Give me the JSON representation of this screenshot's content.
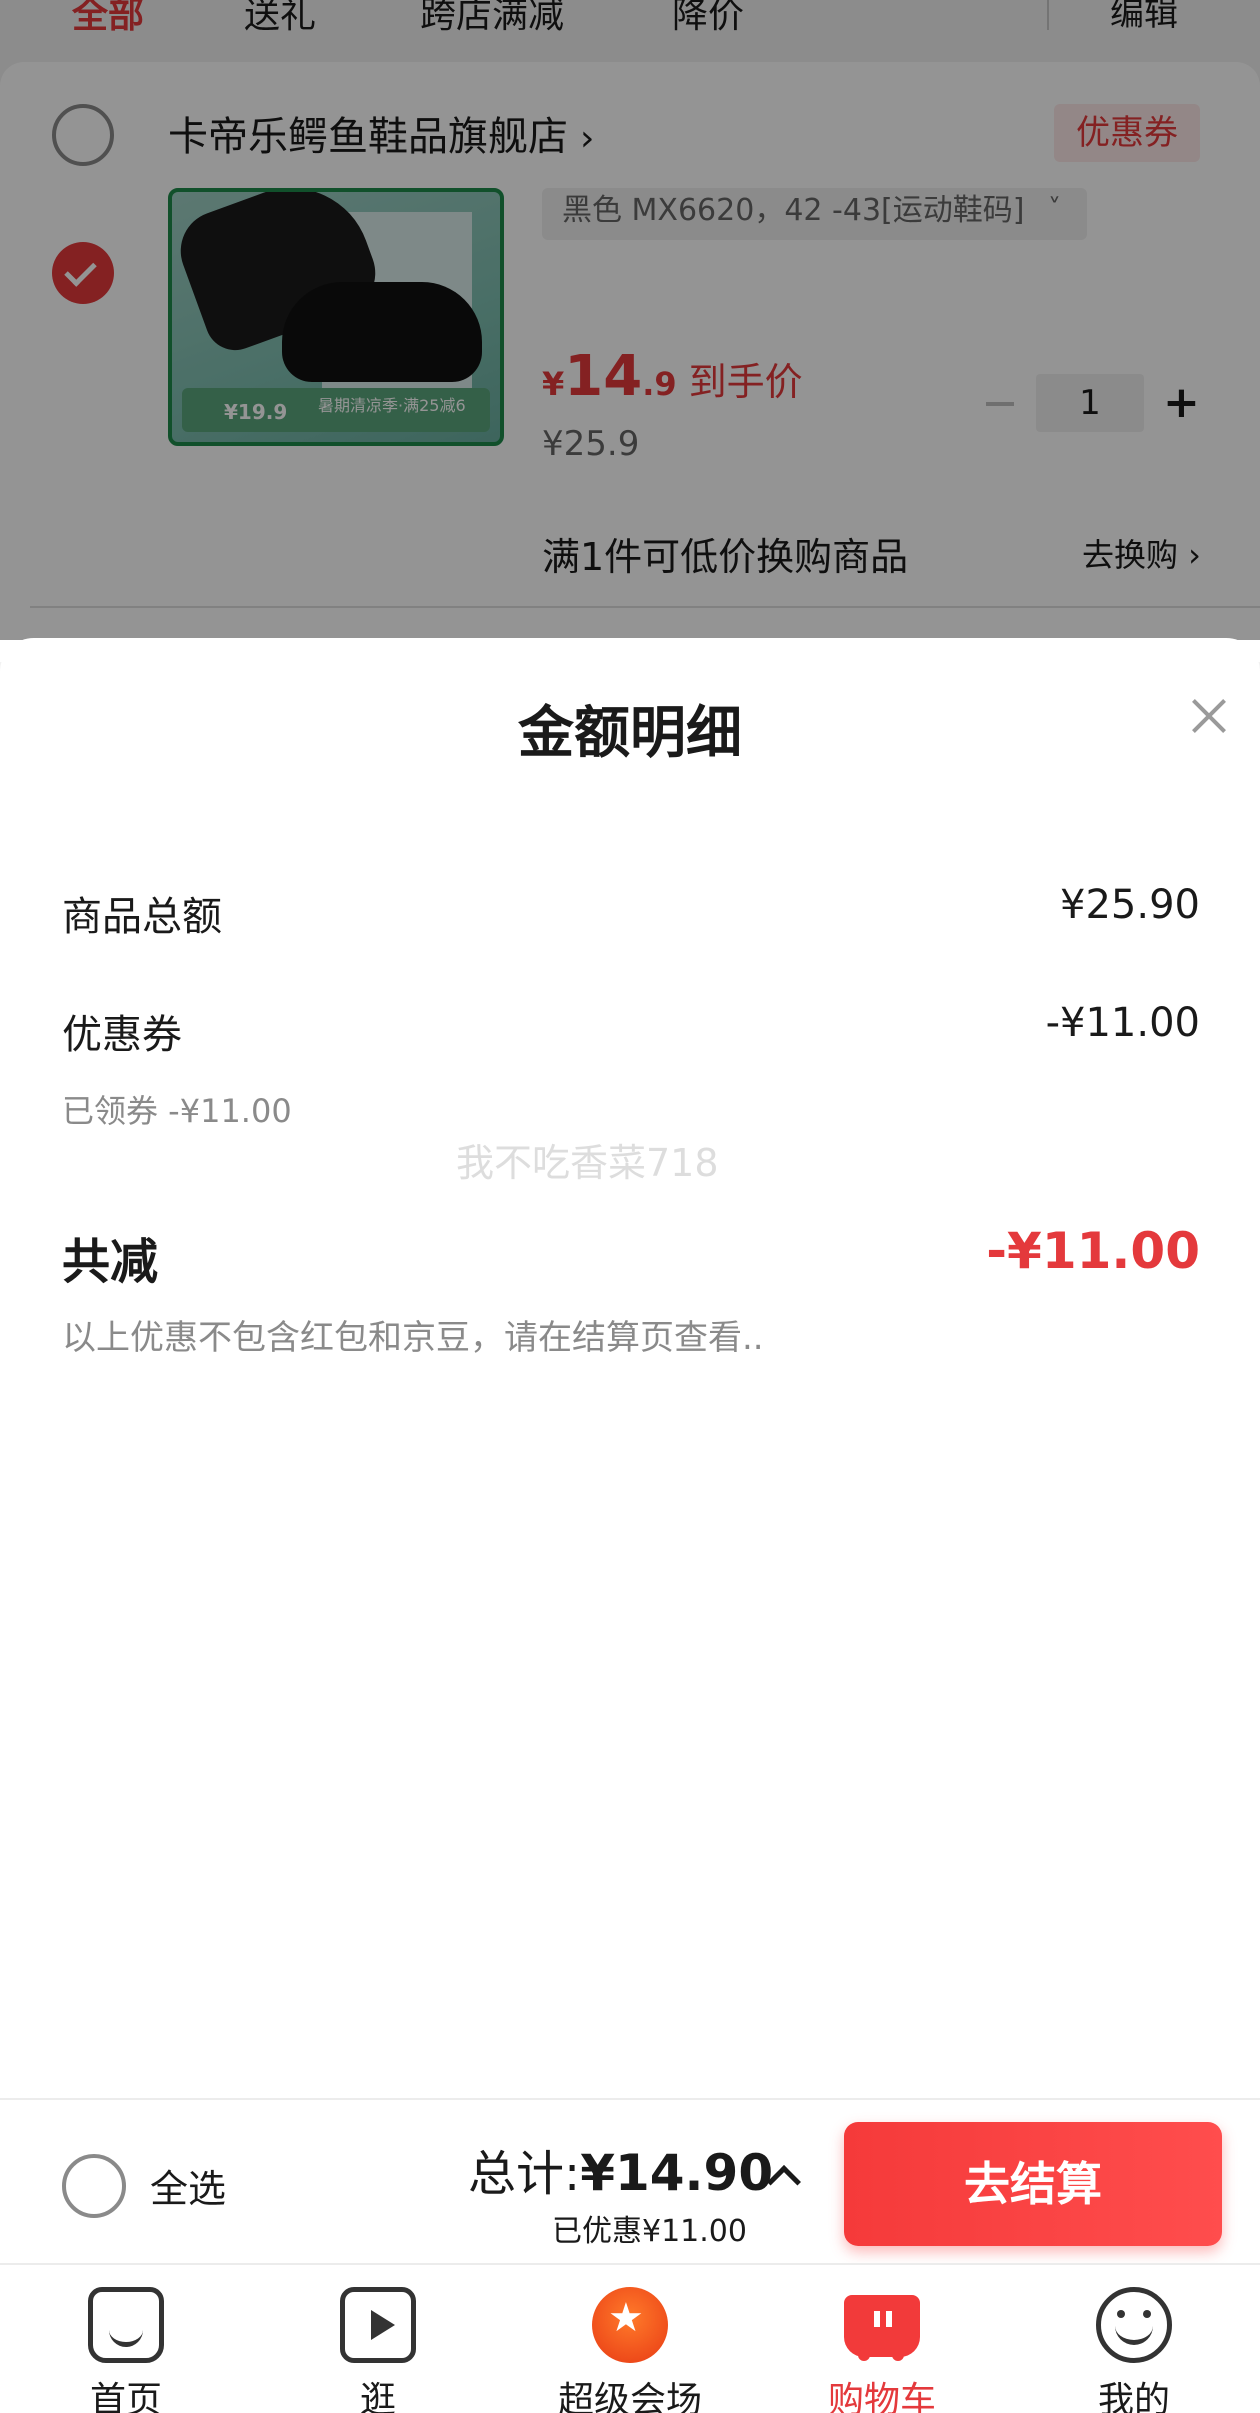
{
  "tabs": {
    "items": [
      {
        "label": "全部",
        "active": true
      },
      {
        "label": "送礼"
      },
      {
        "label": "跨店满减"
      },
      {
        "label": "降价"
      }
    ],
    "edit_label": "编辑"
  },
  "shop": {
    "name": "卡帝乐鳄鱼鞋品旗舰店",
    "arrow": "›",
    "coupon_tag": "优惠券"
  },
  "product": {
    "promo_price": "¥19.9",
    "promo_text": "暑期清凉季·满25减6",
    "sku": "黑色 MX6620，42 -43[运动鞋码]",
    "sku_arrow": "˅",
    "price_yen": "¥",
    "price_int": "14",
    "price_dec": ".9",
    "price_label": "到手价",
    "original_price": "¥25.9",
    "quantity": "1",
    "plus": "+",
    "swap_text": "满1件可低价换购商品",
    "swap_link": "去换购 ›"
  },
  "sheet": {
    "title": "金额明细",
    "goods_total_label": "商品总额",
    "goods_total_value": "¥25.90",
    "coupon_label": "优惠券",
    "coupon_value": "-¥11.00",
    "coupon_sub": "已领券 -¥11.00",
    "total_reduce_label": "共减",
    "total_reduce_value": "-¥11.00",
    "note": "以上优惠不包含红包和京豆，请在结算页查看..",
    "watermark": "我不吃香菜718"
  },
  "checkout": {
    "select_all": "全选",
    "total_prefix": "总计:",
    "total_amount": "¥14.90",
    "saved": "已优惠¥11.00",
    "button": "去结算"
  },
  "nav": {
    "items": [
      {
        "label": "首页",
        "icon": "home-icon"
      },
      {
        "label": "逛",
        "icon": "video-icon"
      },
      {
        "label": "超级会场",
        "icon": "flame-icon"
      },
      {
        "label": "购物车",
        "icon": "cart-icon",
        "active": true
      },
      {
        "label": "我的",
        "icon": "profile-icon"
      }
    ]
  },
  "colors": {
    "accent": "#e4393c",
    "checkout_button": "#f53a3a",
    "product_border": "#1e8b4a"
  }
}
